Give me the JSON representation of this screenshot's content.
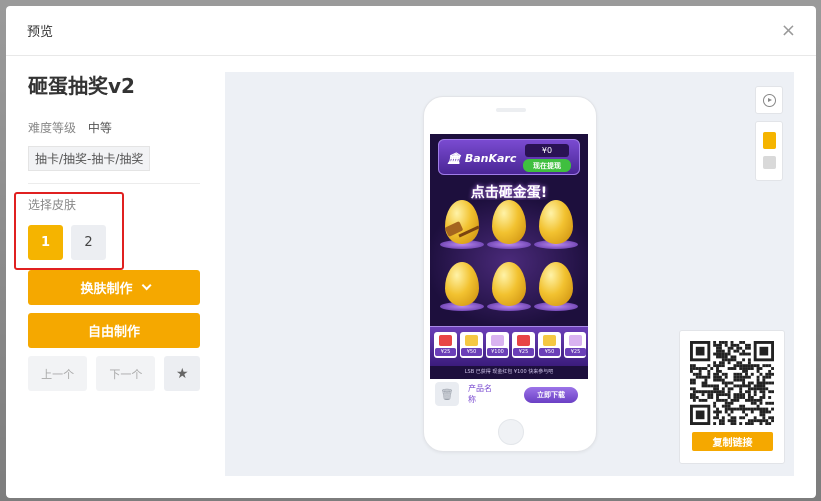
{
  "modal": {
    "title": "预览",
    "close": "×"
  },
  "template": {
    "name": "砸蛋抽奖v2",
    "difficulty_label": "难度等级",
    "difficulty_value": "中等",
    "tag": "抽卡/抽奖-抽卡/抽奖"
  },
  "skins": {
    "label": "选择皮肤",
    "options": [
      "1",
      "2"
    ],
    "selected": "1"
  },
  "actions": {
    "reskin": "换肤制作",
    "free_make": "自由制作",
    "prev": "上一个",
    "next": "下一个",
    "favorite": "★"
  },
  "phone": {
    "brand": "BanKarc",
    "balance": "¥0",
    "cash_button": "现在提现",
    "headline": "点击砸金蛋!",
    "prizes": [
      "¥25",
      "¥50",
      "¥100",
      "¥25",
      "¥50",
      "¥25"
    ],
    "ticker": "LSB 已获得 现金红包 ¥100 快来参与吧",
    "app_name": "产品名称",
    "download": "立即下载"
  },
  "toolbar": {
    "skin_colors": [
      "#f5b400",
      "#d9d9d9"
    ]
  },
  "qr": {
    "copy_link": "复制链接"
  }
}
